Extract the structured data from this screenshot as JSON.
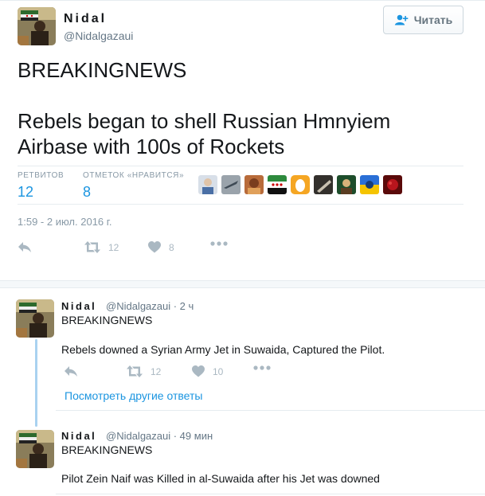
{
  "main_tweet": {
    "author_name": "Nidal",
    "author_handle": "@Nidalgazaui",
    "follow_label": "Читать",
    "text": "BREAKINGNEWS\n\nRebels began to shell Russian Hmnyiem Airbase with 100s of Rockets",
    "retweets_label": "РЕТВИТОВ",
    "retweets_count": "12",
    "likes_label": "ОТМЕТОК «НРАВИТСЯ»",
    "likes_count": "8",
    "timestamp": "1:59 - 2 июл. 2016 г.",
    "action_retweet_count": "12",
    "action_like_count": "8"
  },
  "replies": [
    {
      "author_name": "Nidal",
      "meta": "@Nidalgazaui · 2 ч",
      "line1": "BREAKINGNEWS",
      "line2": "Rebels downed a Syrian Army Jet in Suwaida, Captured the Pilot.",
      "retweet_count": "12",
      "like_count": "10"
    },
    {
      "author_name": "Nidal",
      "meta": "@Nidalgazaui · 49 мин",
      "line1": "BREAKINGNEWS",
      "line2": "Pilot Zein Naif was Killed in al-Suwaida after his Jet was downed"
    }
  ],
  "more_replies_label": "Посмотреть другие ответы",
  "colors": {
    "accent": "#1b95e0",
    "muted": "#aab8c2",
    "border": "#e6ecf0"
  }
}
